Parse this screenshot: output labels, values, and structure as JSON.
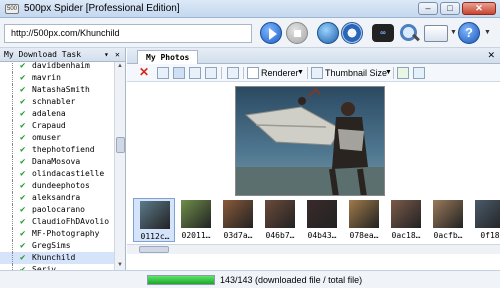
{
  "window": {
    "title": "500px Spider [Professional Edition]",
    "app_icon": "500"
  },
  "toolbar": {
    "url": "http://500px.com/Khunchild",
    "icons": [
      "play-icon",
      "stop-icon",
      "globe-icon",
      "settings-icon",
      "infinity-icon",
      "search-icon",
      "window-icon",
      "help-icon"
    ],
    "help_label": "?",
    "infinity_label": "∞"
  },
  "left_panel": {
    "title": "My Download Task",
    "items": [
      "davidbenhaim",
      "mavrin",
      "NatashaSmith",
      "schnabler",
      "adalena",
      "Crapaud",
      "omuser",
      "thephotofiend",
      "DanaMosova",
      "olindacastielle",
      "dundeephotos",
      "aleksandra",
      "paolocarano",
      "ClaudioFhDAvolio",
      "MF-Photography",
      "GregSims",
      "Khunchild",
      "Seriv"
    ],
    "selected_index": 16
  },
  "right_panel": {
    "tab_label": "My Photos",
    "renderer_label": "Renderer",
    "thumbnail_size_label": "Thumbnail Size",
    "thumbnails": [
      {
        "caption": "0112c…",
        "color": "#5c7a8a"
      },
      {
        "caption": "02011…",
        "color": "#6f8f4a"
      },
      {
        "caption": "03d7a…",
        "color": "#8a5a3a"
      },
      {
        "caption": "046b7…",
        "color": "#6b4a3a"
      },
      {
        "caption": "04b43…",
        "color": "#3a2a2a"
      },
      {
        "caption": "078ea…",
        "color": "#a07a4a"
      },
      {
        "caption": "0ac18…",
        "color": "#7a5a4a"
      },
      {
        "caption": "0acfb…",
        "color": "#9a7a5a"
      },
      {
        "caption": "0f18",
        "color": "#4a5a6a"
      }
    ]
  },
  "status": {
    "progress": 1.0,
    "text": "143/143 (downloaded file / total file)"
  },
  "colors": {
    "accent": "#1d9a27",
    "selection": "#d5e4fb",
    "progress": "#1aa829"
  }
}
